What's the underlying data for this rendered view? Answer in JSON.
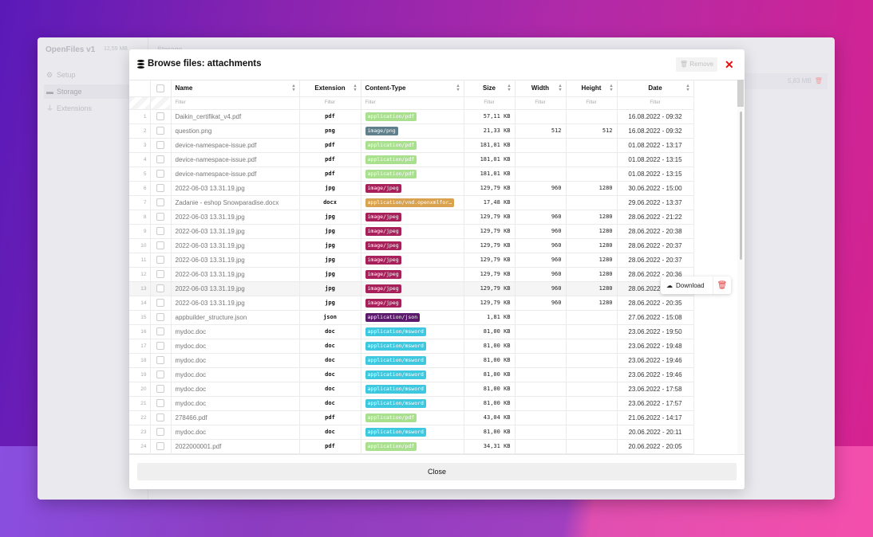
{
  "app": {
    "title": "OpenFiles v1",
    "total_size": "12,59 MB",
    "header": "Storage",
    "sidebar": [
      {
        "label": "Setup",
        "icon": "gear-icon"
      },
      {
        "label": "Storage",
        "icon": "drive-icon",
        "active": true
      },
      {
        "label": "Extensions",
        "icon": "plug-icon"
      }
    ],
    "storage_row_size": "5,83 MB"
  },
  "modal": {
    "title": "Browse files: attachments",
    "remove_label": "Remove",
    "close_label": "Close",
    "columns": [
      "Name",
      "Extension",
      "Content-Type",
      "Size",
      "Width",
      "Height",
      "Date"
    ],
    "filter_placeholder": "Filter",
    "context_menu": {
      "download_label": "Download",
      "highlighted_row": 13
    },
    "badge_colors": {
      "application/pdf": "#a9e08e",
      "image/png": "#5f7f8b",
      "image/jpeg": "#a8205a",
      "application/vnd.openxmlfor…": "#d9a24e",
      "application/json": "#5b1a6b",
      "application/msword": "#3ec8e0"
    },
    "rows": [
      {
        "n": "1",
        "name": "Daikin_certifikat_v4.pdf",
        "ext": "pdf",
        "type": "application/pdf",
        "size": "57,11 KB",
        "w": "",
        "h": "",
        "date": "16.08.2022 - 09:32"
      },
      {
        "n": "2",
        "name": "question.png",
        "ext": "png",
        "type": "image/png",
        "size": "21,33 KB",
        "w": "512",
        "h": "512",
        "date": "16.08.2022 - 09:32"
      },
      {
        "n": "3",
        "name": "device-namespace-issue.pdf",
        "ext": "pdf",
        "type": "application/pdf",
        "size": "181,01 KB",
        "w": "",
        "h": "",
        "date": "01.08.2022 - 13:17"
      },
      {
        "n": "4",
        "name": "device-namespace-issue.pdf",
        "ext": "pdf",
        "type": "application/pdf",
        "size": "181,01 KB",
        "w": "",
        "h": "",
        "date": "01.08.2022 - 13:15"
      },
      {
        "n": "5",
        "name": "device-namespace-issue.pdf",
        "ext": "pdf",
        "type": "application/pdf",
        "size": "181,01 KB",
        "w": "",
        "h": "",
        "date": "01.08.2022 - 13:15"
      },
      {
        "n": "6",
        "name": "2022-06-03 13.31.19.jpg",
        "ext": "jpg",
        "type": "image/jpeg",
        "size": "129,79 KB",
        "w": "960",
        "h": "1280",
        "date": "30.06.2022 - 15:00"
      },
      {
        "n": "7",
        "name": "Zadanie - eshop Snowparadise.docx",
        "ext": "docx",
        "type": "application/vnd.openxmlfor…",
        "size": "17,48 KB",
        "w": "",
        "h": "",
        "date": "29.06.2022 - 13:37"
      },
      {
        "n": "8",
        "name": "2022-06-03 13.31.19.jpg",
        "ext": "jpg",
        "type": "image/jpeg",
        "size": "129,79 KB",
        "w": "960",
        "h": "1280",
        "date": "28.06.2022 - 21:22"
      },
      {
        "n": "9",
        "name": "2022-06-03 13.31.19.jpg",
        "ext": "jpg",
        "type": "image/jpeg",
        "size": "129,79 KB",
        "w": "960",
        "h": "1280",
        "date": "28.06.2022 - 20:38"
      },
      {
        "n": "10",
        "name": "2022-06-03 13.31.19.jpg",
        "ext": "jpg",
        "type": "image/jpeg",
        "size": "129,79 KB",
        "w": "960",
        "h": "1280",
        "date": "28.06.2022 - 20:37"
      },
      {
        "n": "11",
        "name": "2022-06-03 13.31.19.jpg",
        "ext": "jpg",
        "type": "image/jpeg",
        "size": "129,79 KB",
        "w": "960",
        "h": "1280",
        "date": "28.06.2022 - 20:37"
      },
      {
        "n": "12",
        "name": "2022-06-03 13.31.19.jpg",
        "ext": "jpg",
        "type": "image/jpeg",
        "size": "129,79 KB",
        "w": "960",
        "h": "1280",
        "date": "28.06.2022 - 20:36"
      },
      {
        "n": "13",
        "name": "2022-06-03 13.31.19.jpg",
        "ext": "jpg",
        "type": "image/jpeg",
        "size": "129,79 KB",
        "w": "960",
        "h": "1280",
        "date": "28.06.2022 - 20:36"
      },
      {
        "n": "14",
        "name": "2022-06-03 13.31.19.jpg",
        "ext": "jpg",
        "type": "image/jpeg",
        "size": "129,79 KB",
        "w": "960",
        "h": "1280",
        "date": "28.06.2022 - 20:35"
      },
      {
        "n": "15",
        "name": "appbuilder_structure.json",
        "ext": "json",
        "type": "application/json",
        "size": "1,81 KB",
        "w": "",
        "h": "",
        "date": "27.06.2022 - 15:08"
      },
      {
        "n": "16",
        "name": "mydoc.doc",
        "ext": "doc",
        "type": "application/msword",
        "size": "81,00 KB",
        "w": "",
        "h": "",
        "date": "23.06.2022 - 19:50"
      },
      {
        "n": "17",
        "name": "mydoc.doc",
        "ext": "doc",
        "type": "application/msword",
        "size": "81,00 KB",
        "w": "",
        "h": "",
        "date": "23.06.2022 - 19:48"
      },
      {
        "n": "18",
        "name": "mydoc.doc",
        "ext": "doc",
        "type": "application/msword",
        "size": "81,00 KB",
        "w": "",
        "h": "",
        "date": "23.06.2022 - 19:46"
      },
      {
        "n": "19",
        "name": "mydoc.doc",
        "ext": "doc",
        "type": "application/msword",
        "size": "81,00 KB",
        "w": "",
        "h": "",
        "date": "23.06.2022 - 19:46"
      },
      {
        "n": "20",
        "name": "mydoc.doc",
        "ext": "doc",
        "type": "application/msword",
        "size": "81,00 KB",
        "w": "",
        "h": "",
        "date": "23.06.2022 - 17:58"
      },
      {
        "n": "21",
        "name": "mydoc.doc",
        "ext": "doc",
        "type": "application/msword",
        "size": "81,00 KB",
        "w": "",
        "h": "",
        "date": "23.06.2022 - 17:57"
      },
      {
        "n": "22",
        "name": "278466.pdf",
        "ext": "pdf",
        "type": "application/pdf",
        "size": "43,04 KB",
        "w": "",
        "h": "",
        "date": "21.06.2022 - 14:17"
      },
      {
        "n": "23",
        "name": "mydoc.doc",
        "ext": "doc",
        "type": "application/msword",
        "size": "81,00 KB",
        "w": "",
        "h": "",
        "date": "20.06.2022 - 20:11"
      },
      {
        "n": "24",
        "name": "2022000001.pdf",
        "ext": "pdf",
        "type": "application/pdf",
        "size": "34,31 KB",
        "w": "",
        "h": "",
        "date": "20.06.2022 - 20:05"
      }
    ]
  }
}
